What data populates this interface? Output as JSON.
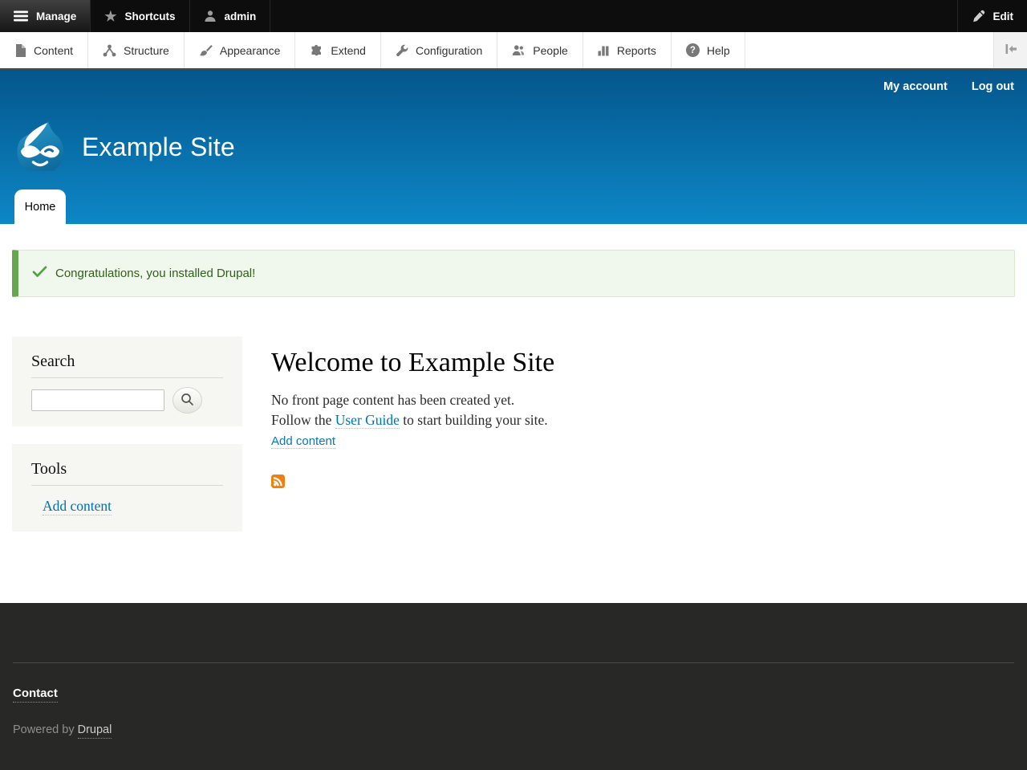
{
  "colors": {
    "accent-blue": "#0071b3",
    "header-top": "#04568c",
    "header-bottom": "#0d87c6",
    "status-green": "#66a74e",
    "status-bg": "#f0f7ec",
    "status-text": "#325e1c",
    "sidebar-bg": "#f6f6f2",
    "footer-bg": "#282826",
    "rss-orange": "#ee7f11"
  },
  "admin_bar": {
    "manage": "Manage",
    "shortcuts": "Shortcuts",
    "user": "admin",
    "edit": "Edit",
    "icons": [
      "hamburger-icon",
      "star-icon",
      "user-icon",
      "pencil-icon"
    ]
  },
  "toolbar": {
    "items": [
      {
        "label": "Content",
        "icon": "file-icon"
      },
      {
        "label": "Structure",
        "icon": "sitemap-icon"
      },
      {
        "label": "Appearance",
        "icon": "paintbrush-icon"
      },
      {
        "label": "Extend",
        "icon": "puzzle-icon"
      },
      {
        "label": "Configuration",
        "icon": "wrench-icon"
      },
      {
        "label": "People",
        "icon": "people-icon"
      },
      {
        "label": "Reports",
        "icon": "barchart-icon"
      },
      {
        "label": "Help",
        "icon": "question-icon"
      }
    ],
    "help_glyph": "?",
    "collapse_icon": "collapse-left-icon"
  },
  "header": {
    "site_name": "Example Site",
    "my_account": "My account",
    "log_out": "Log out",
    "home_tab": "Home",
    "logo_icon": "druplicon-logo"
  },
  "status": {
    "message": "Congratulations, you installed Drupal!",
    "icon": "checkmark-icon"
  },
  "sidebar": {
    "search_title": "Search",
    "search_placeholder": "",
    "search_value": "",
    "tools_title": "Tools",
    "tools_link": "Add content"
  },
  "content": {
    "title": "Welcome to Example Site",
    "line1": "No front page content has been created yet.",
    "line2_before": "Follow the ",
    "line2_link": "User Guide",
    "line2_after": " to start building your site.",
    "add_content": "Add content",
    "feed_icon": "rss-icon"
  },
  "footer": {
    "contact": "Contact",
    "powered_by": "Powered by ",
    "drupal": "Drupal"
  }
}
